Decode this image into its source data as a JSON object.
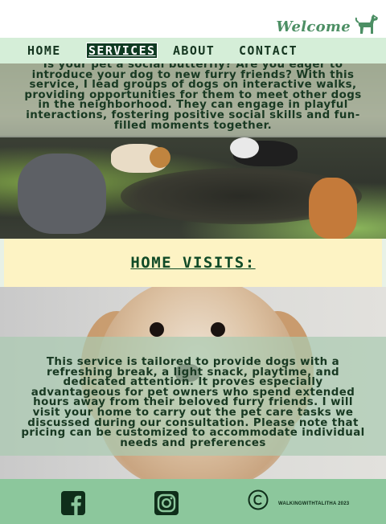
{
  "brand": {
    "name": "Welcome",
    "icon": "dog-icon"
  },
  "nav": {
    "items": [
      {
        "label": "HOME",
        "active": false
      },
      {
        "label": "SERVICES",
        "active": true
      },
      {
        "label": "ABOUT",
        "active": false
      },
      {
        "label": "CONTACT",
        "active": false
      }
    ]
  },
  "walks": {
    "description": "Is your pet a social butterfly? Are you eager to introduce your dog to new furry friends? With this service, I lead groups of dogs on interactive walks, providing opportunities for them to meet other dogs in the neighborhood. They can engage in playful interactions, fostering positive social skills and fun-filled moments together."
  },
  "home_visits": {
    "heading": "HOME VISITS:",
    "description": "This service is tailored to provide dogs with a refreshing break, a light snack, playtime, and dedicated attention. It proves especially advantageous for pet owners who spend extended hours away from their beloved furry friends. I will visit your home to carry out the pet care tasks we discussed during our consultation. Please note that pricing can be customized to accommodate individual needs and preferences"
  },
  "footer": {
    "social": [
      "facebook-icon",
      "instagram-icon"
    ],
    "copyright": "WALKINGWITHTALITHA 2023"
  },
  "colors": {
    "nav_bg": "#d5eed8",
    "accent": "#4c8f64",
    "heading_bg": "#fdf3c4",
    "footer_bg": "#8cc79c",
    "text_dark": "#183922"
  }
}
